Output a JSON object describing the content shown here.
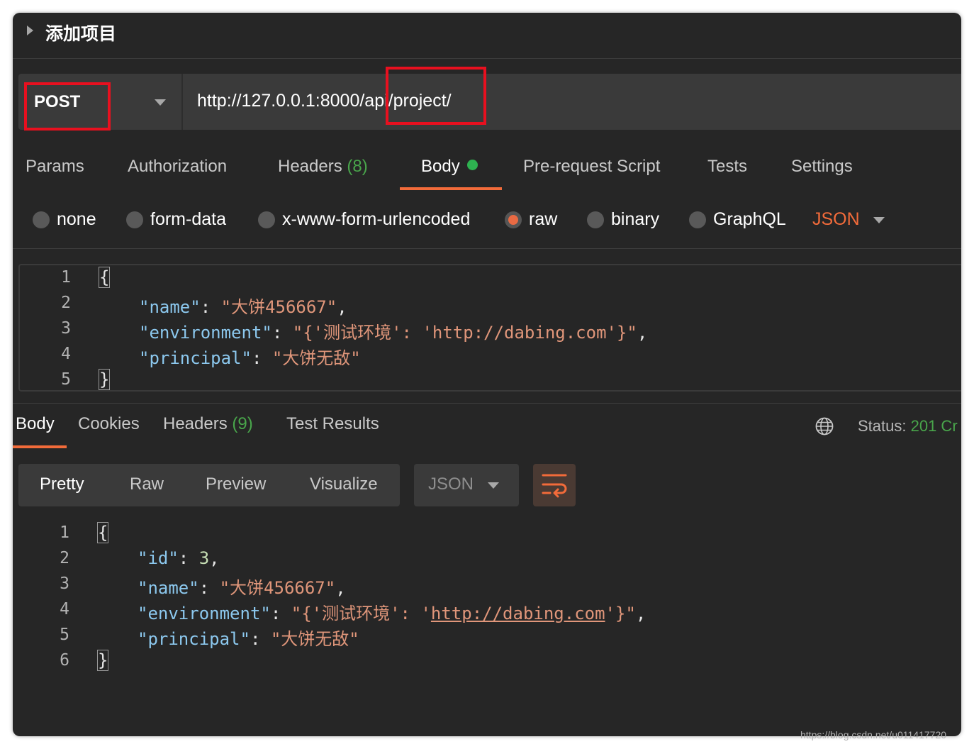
{
  "header": {
    "title": "添加项目"
  },
  "request": {
    "method": "POST",
    "url": "http://127.0.0.1:8000/api/project/"
  },
  "request_tabs": {
    "params": "Params",
    "authorization": "Authorization",
    "headers": "Headers",
    "headers_count": "(8)",
    "body": "Body",
    "pre_request": "Pre-request Script",
    "tests": "Tests",
    "settings": "Settings"
  },
  "body_types": {
    "none": "none",
    "form_data": "form-data",
    "urlencoded": "x-www-form-urlencoded",
    "raw": "raw",
    "binary": "binary",
    "graphql": "GraphQL",
    "selected_format": "JSON"
  },
  "request_body": {
    "line_numbers": [
      "1",
      "2",
      "3",
      "4",
      "5"
    ],
    "open_brace": "{",
    "close_brace": "}",
    "k_name": "\"name\"",
    "v_name": "\"大饼456667\"",
    "k_env": "\"environment\"",
    "v_env": "\"{'测试环境': 'http://dabing.com'}\"",
    "k_principal": "\"principal\"",
    "v_principal": "\"大饼无敌\""
  },
  "response_tabs": {
    "body": "Body",
    "cookies": "Cookies",
    "headers": "Headers",
    "headers_count": "(9)",
    "test_results": "Test Results"
  },
  "status": {
    "label": "Status:",
    "value": "201 Cr"
  },
  "view_modes": {
    "pretty": "Pretty",
    "raw": "Raw",
    "preview": "Preview",
    "visualize": "Visualize",
    "format": "JSON"
  },
  "response_body": {
    "line_numbers": [
      "1",
      "2",
      "3",
      "4",
      "5",
      "6"
    ],
    "open_brace": "{",
    "close_brace": "}",
    "k_id": "\"id\"",
    "v_id": "3",
    "k_name": "\"name\"",
    "v_name": "\"大饼456667\"",
    "k_env": "\"environment\"",
    "v_env_pre": "\"{'测试环境': '",
    "v_env_link": "http://dabing.com",
    "v_env_post": "'}\"",
    "k_principal": "\"principal\"",
    "v_principal": "\"大饼无敌\""
  },
  "watermark": "https://blog.csdn.net/u011417720",
  "colors": {
    "accent": "#f26b3a",
    "green": "#49a54b",
    "annotation_red": "#e8101f"
  }
}
